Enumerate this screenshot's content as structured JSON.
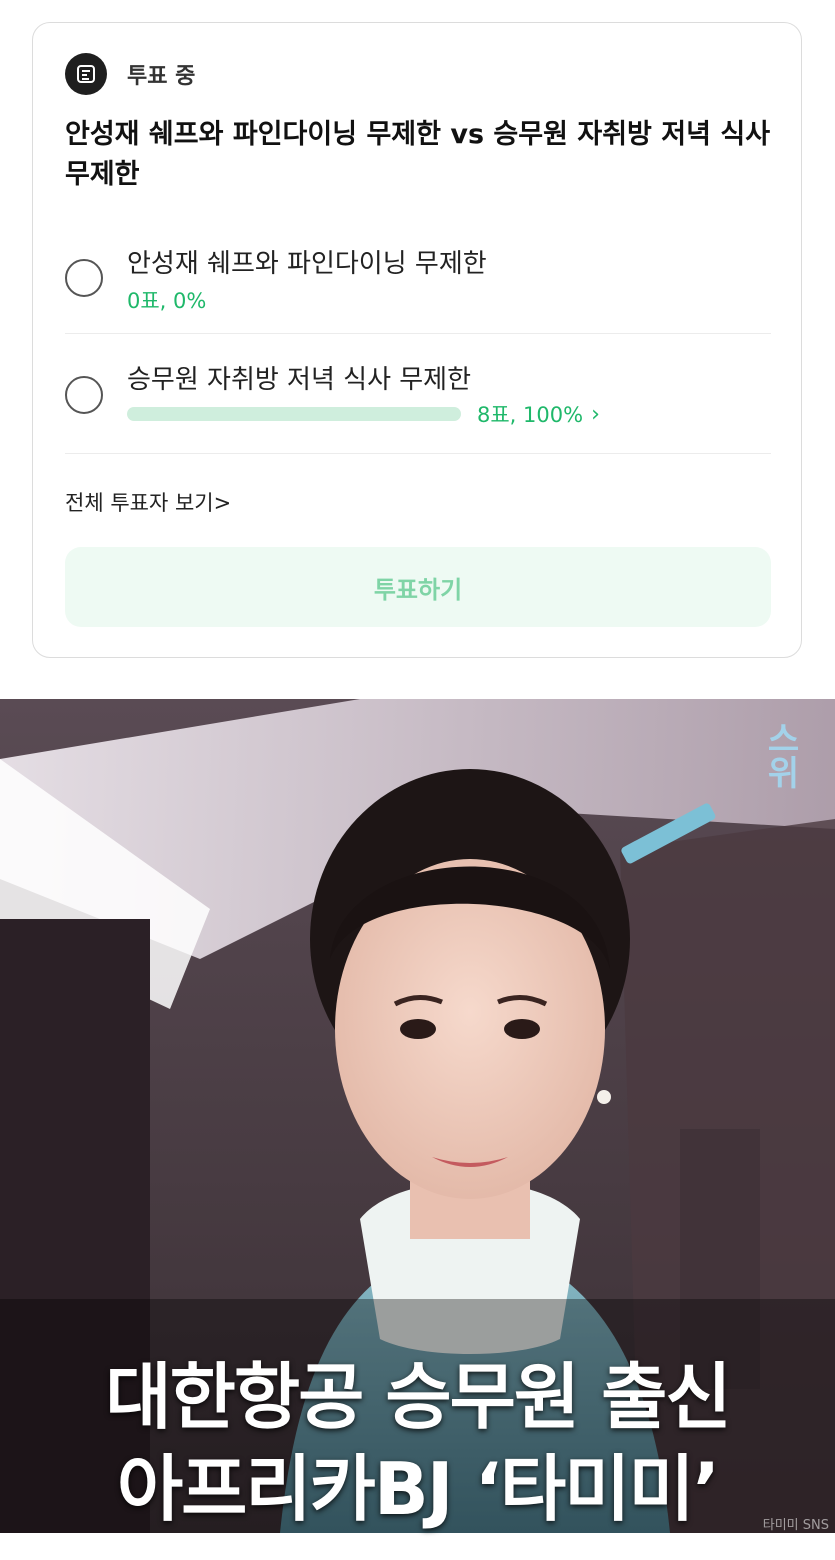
{
  "poll": {
    "status": "투표 중",
    "question": "안성재 쉐프와 파인다이닝 무제한 vs 승무원 자취방 저녁 식사 무제한",
    "options": [
      {
        "label": "안성재 쉐프와 파인다이닝 무제한",
        "result": "0표, 0%",
        "percent": 0
      },
      {
        "label": "승무원 자취방 저녁 식사 무제한",
        "result": "8표, 100%",
        "percent": 100
      }
    ],
    "all_voters_link": "전체 투표자 보기>",
    "vote_button": "투표하기"
  },
  "image": {
    "caption_line1": "대한항공 승무원 출신",
    "caption_line2": "아프리카BJ ‘타미미’",
    "credit": "타미미 SNS",
    "corner_logo": "스위"
  },
  "colors": {
    "accent_green": "#1fb86a",
    "button_bg": "#eefaf3",
    "button_text": "#7fd4a6"
  }
}
